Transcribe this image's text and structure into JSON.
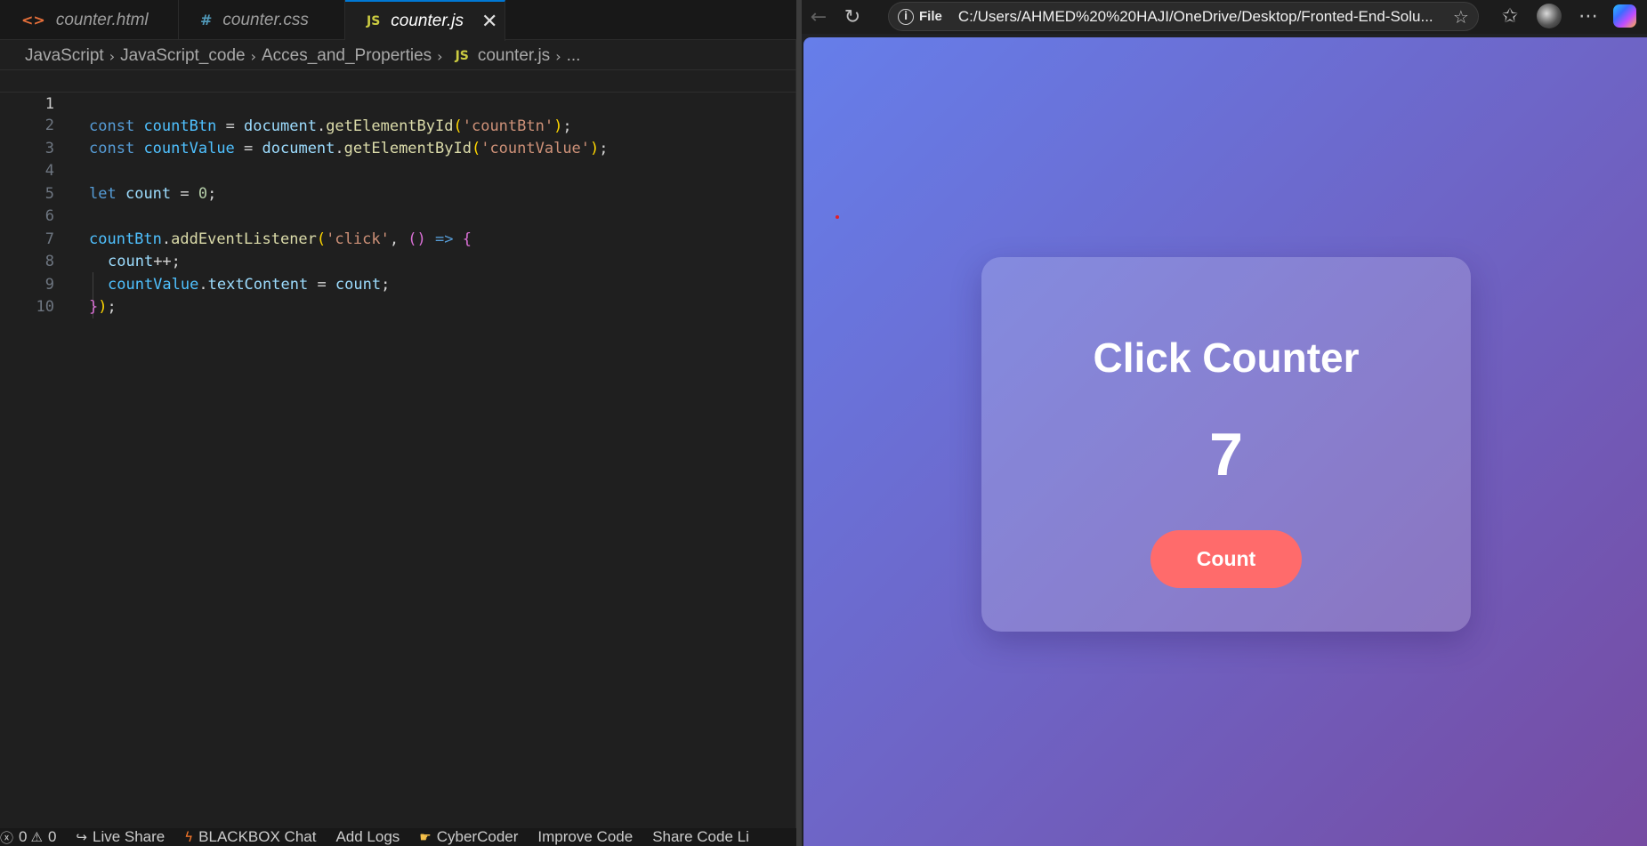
{
  "editor": {
    "tabs": [
      {
        "label": "counter.html",
        "icon": "<>"
      },
      {
        "label": "counter.css",
        "icon": "#"
      },
      {
        "label": "counter.js",
        "icon": "JS",
        "close": "✕"
      }
    ],
    "breadcrumb": [
      "JavaScript",
      "JavaScript_code",
      "Acces_and_Properties",
      "counter.js",
      "..."
    ],
    "line_numbers": [
      "1",
      "2",
      "3",
      "4",
      "5",
      "6",
      "7",
      "8",
      "9",
      "10"
    ],
    "code": {
      "l1": {
        "kw": "const",
        "var": "countBtn",
        "eq": " = ",
        "obj": "document",
        "dot": ".",
        "fn": "getElementById",
        "open": "(",
        "str": "'countBtn'",
        "close": ")",
        "semi": ";"
      },
      "l2": {
        "kw": "const",
        "var": "countValue",
        "eq": " = ",
        "obj": "document",
        "dot": ".",
        "fn": "getElementById",
        "open": "(",
        "str": "'countValue'",
        "close": ")",
        "semi": ";"
      },
      "l4": {
        "kw": "let",
        "var": "count",
        "eq": " = ",
        "num": "0",
        "semi": ";"
      },
      "l6": {
        "obj": "countBtn",
        "dot": ".",
        "fn": "addEventListener",
        "open": "(",
        "str": "'click'",
        "comma": ", ",
        "args": "()",
        "arrow": " => ",
        "brace": "{"
      },
      "l7": {
        "var": "count",
        "op": "++",
        "semi": ";"
      },
      "l8": {
        "obj": "countValue",
        "dot": ".",
        "prop": "textContent",
        "eq": " = ",
        "var": "count",
        "semi": ";"
      },
      "l9": {
        "brace": "}",
        "close": ")",
        "semi": ";"
      }
    },
    "statusbar": {
      "problems": "0",
      "warnings": "0",
      "live_share": "Live Share",
      "blackbox": "BLACKBOX Chat",
      "add_logs": "Add Logs",
      "cybercoder": "CyberCoder",
      "improve": "Improve Code",
      "share": "Share Code Li"
    }
  },
  "browser": {
    "scheme_label": "File",
    "url": "C:/Users/AHMED%20%20HAJI/OneDrive/Desktop/Fronted-End-Solu...",
    "page": {
      "title": "Click Counter",
      "value": "7",
      "button_label": "Count"
    },
    "colors": {
      "gradient_start": "#667eea",
      "gradient_end": "#764ba2",
      "button": "#ff6b6b"
    }
  }
}
